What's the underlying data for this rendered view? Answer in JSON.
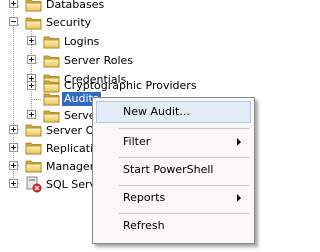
{
  "tree": {
    "databases": "Databases",
    "security": "Security",
    "logins": "Logins",
    "server_roles": "Server Roles",
    "credentials": "Credentials",
    "crypto_providers": "Cryptographic Providers",
    "audits": "Audits",
    "server_audit_specs": "Server Audit Specifications",
    "server_objects": "Server Objects",
    "replication": "Replication",
    "management": "Management",
    "sql_server_agent": "SQL Server Agent"
  },
  "context_menu": {
    "new_audit": "New Audit...",
    "filter": "Filter",
    "start_powershell": "Start PowerShell",
    "reports": "Reports",
    "refresh": "Refresh"
  },
  "colors": {
    "selection": "#316ac5",
    "menu_background": "#f9f8f4",
    "menu_highlight": "#e4ecf7"
  }
}
